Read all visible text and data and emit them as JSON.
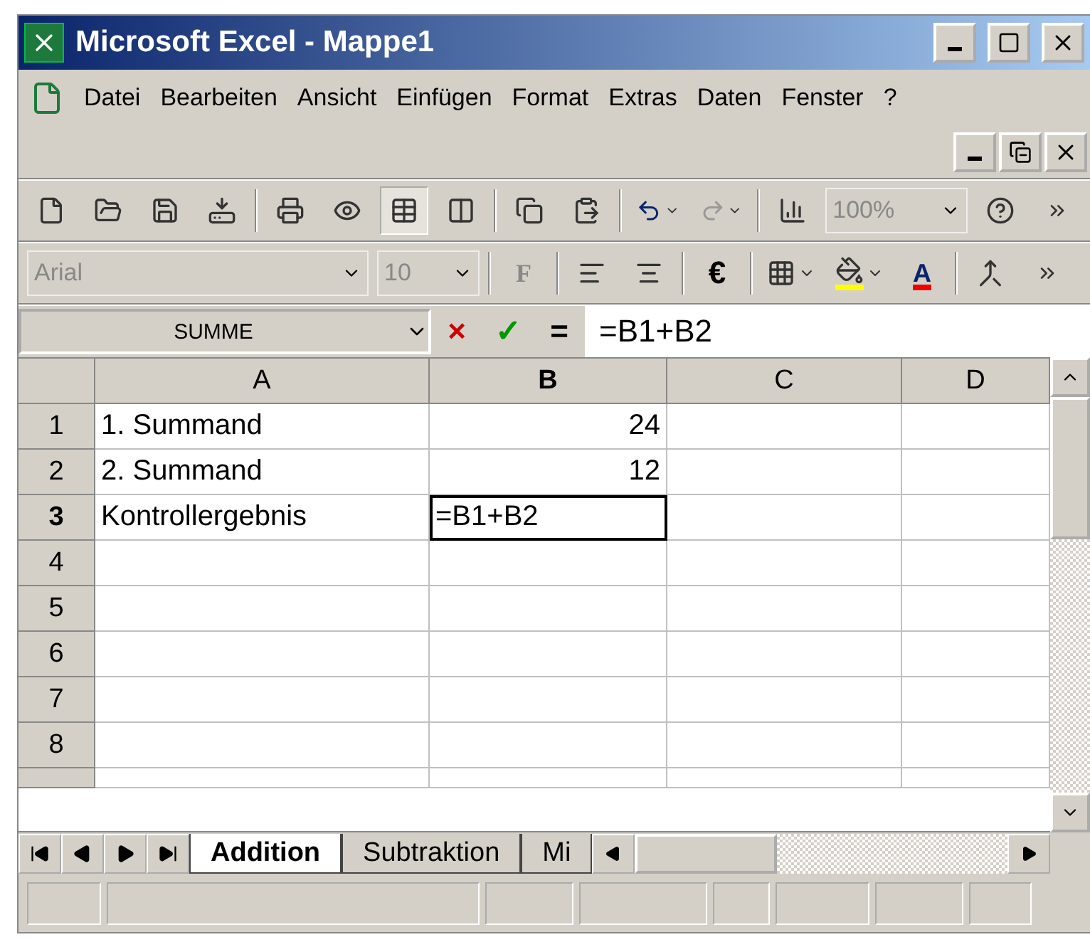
{
  "window": {
    "title": "Microsoft Excel - Mappe1"
  },
  "menu": [
    {
      "label": "Datei"
    },
    {
      "label": "Bearbeiten"
    },
    {
      "label": "Ansicht"
    },
    {
      "label": "Einfügen"
    },
    {
      "label": "Format"
    },
    {
      "label": "Extras"
    },
    {
      "label": "Daten"
    },
    {
      "label": "Fenster"
    },
    {
      "label": "?"
    }
  ],
  "standard_toolbar": {
    "zoom": "100%"
  },
  "format_toolbar": {
    "font": "Arial",
    "size": "10",
    "bold": "F",
    "currency": "€",
    "font_color": "A"
  },
  "formula_bar": {
    "name_box": "SUMME",
    "cancel": "×",
    "enter": "✓",
    "equals": "=",
    "formula": "=B1+B2"
  },
  "sheet": {
    "columns": [
      {
        "label": "A",
        "selected": false
      },
      {
        "label": "B",
        "selected": true
      },
      {
        "label": "C",
        "selected": false
      },
      {
        "label": "D",
        "selected": false
      }
    ],
    "rows": [
      {
        "label": "1",
        "selected": false,
        "cells": [
          {
            "text": "1. Summand",
            "kind": "text",
            "editing": false
          },
          {
            "text": "24",
            "kind": "number",
            "editing": false
          }
        ]
      },
      {
        "label": "2",
        "selected": false,
        "cells": [
          {
            "text": "2. Summand",
            "kind": "text",
            "editing": false
          },
          {
            "text": "12",
            "kind": "number",
            "editing": false
          }
        ]
      },
      {
        "label": "3",
        "selected": true,
        "cells": [
          {
            "text": "Kontrollergebnis",
            "kind": "text",
            "editing": false
          },
          {
            "text": "=B1+B2",
            "kind": "text",
            "editing": true
          }
        ]
      },
      {
        "label": "4",
        "selected": false
      },
      {
        "label": "5",
        "selected": false
      },
      {
        "label": "6",
        "selected": false
      },
      {
        "label": "7",
        "selected": false
      },
      {
        "label": "8",
        "selected": false
      }
    ]
  },
  "sheet_tabs": [
    {
      "label": "Addition",
      "selected": true
    },
    {
      "label": "Subtraktion",
      "selected": false
    },
    {
      "label": "Mi",
      "selected": false
    }
  ]
}
